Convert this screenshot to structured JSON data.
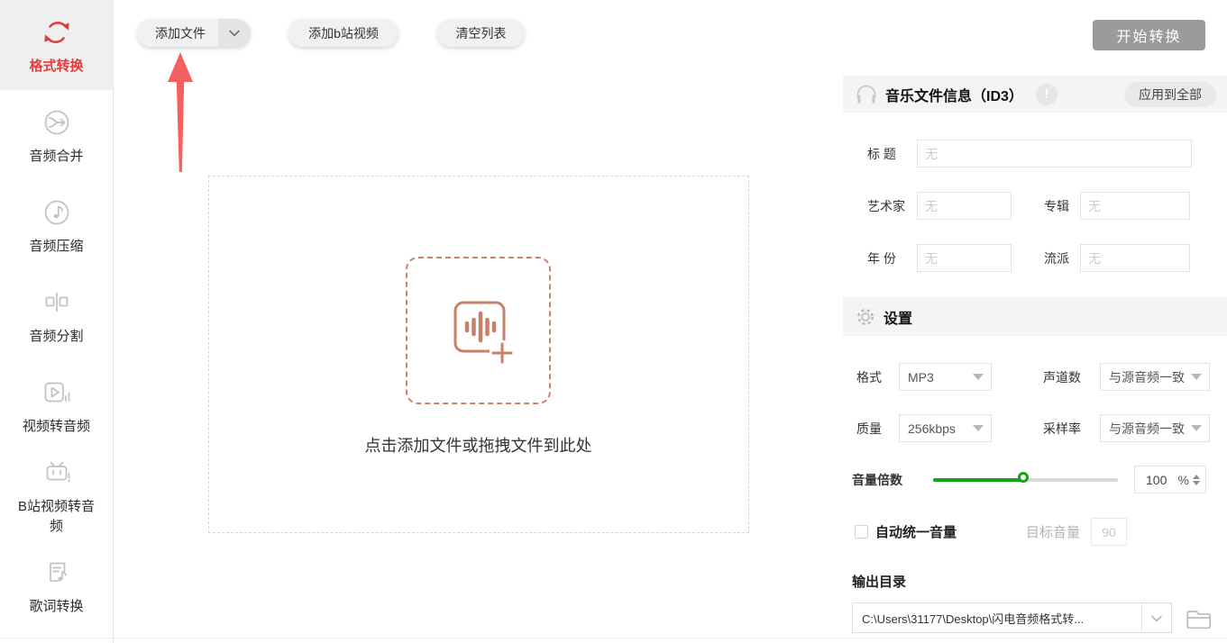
{
  "colors": {
    "accent_red": "#e23c3c",
    "arrow_red": "#f45f5f",
    "slider_green": "#17a317",
    "dropzone_icon": "#c9806a",
    "start_button_bg": "#9b9b9b"
  },
  "sidebar": {
    "items": [
      {
        "label": "格式转换",
        "active": true
      },
      {
        "label": "音频合并",
        "active": false
      },
      {
        "label": "音频压缩",
        "active": false
      },
      {
        "label": "音频分割",
        "active": false
      },
      {
        "label": "视频转音频",
        "active": false
      },
      {
        "label": "B站视频转音频",
        "active": false
      },
      {
        "label": "歌词转换",
        "active": false
      }
    ]
  },
  "toolbar": {
    "add_file_label": "添加文件",
    "add_bilibili_label": "添加b站视频",
    "clear_list_label": "清空列表",
    "start_label": "开始转换"
  },
  "dropzone": {
    "hint": "点击添加文件或拖拽文件到此处"
  },
  "id3_panel": {
    "title": "音乐文件信息（ID3）",
    "apply_all_label": "应用到全部",
    "info_badge": "!",
    "fields": {
      "title_label": "标 题",
      "title_placeholder": "无",
      "artist_label": "艺术家",
      "artist_placeholder": "无",
      "album_label": "专辑",
      "album_placeholder": "无",
      "year_label": "年 份",
      "year_placeholder": "无",
      "genre_label": "流派",
      "genre_placeholder": "无"
    }
  },
  "settings_panel": {
    "title": "设置",
    "format_label": "格式",
    "format_value": "MP3",
    "channels_label": "声道数",
    "channels_value": "与源音频一致",
    "quality_label": "质量",
    "quality_value": "256kbps",
    "samplerate_label": "采样率",
    "samplerate_value": "与源音频一致",
    "volume_label": "音量倍数",
    "volume_value": "100",
    "volume_unit": "%",
    "volume_percent": 100,
    "auto_normalize_label": "自动统一音量",
    "auto_normalize_checked": false,
    "target_volume_label": "目标音量",
    "target_volume_value": "90",
    "output_dir_label": "输出目录",
    "output_dir_value": "C:\\Users\\31177\\Desktop\\闪电音频格式转..."
  }
}
